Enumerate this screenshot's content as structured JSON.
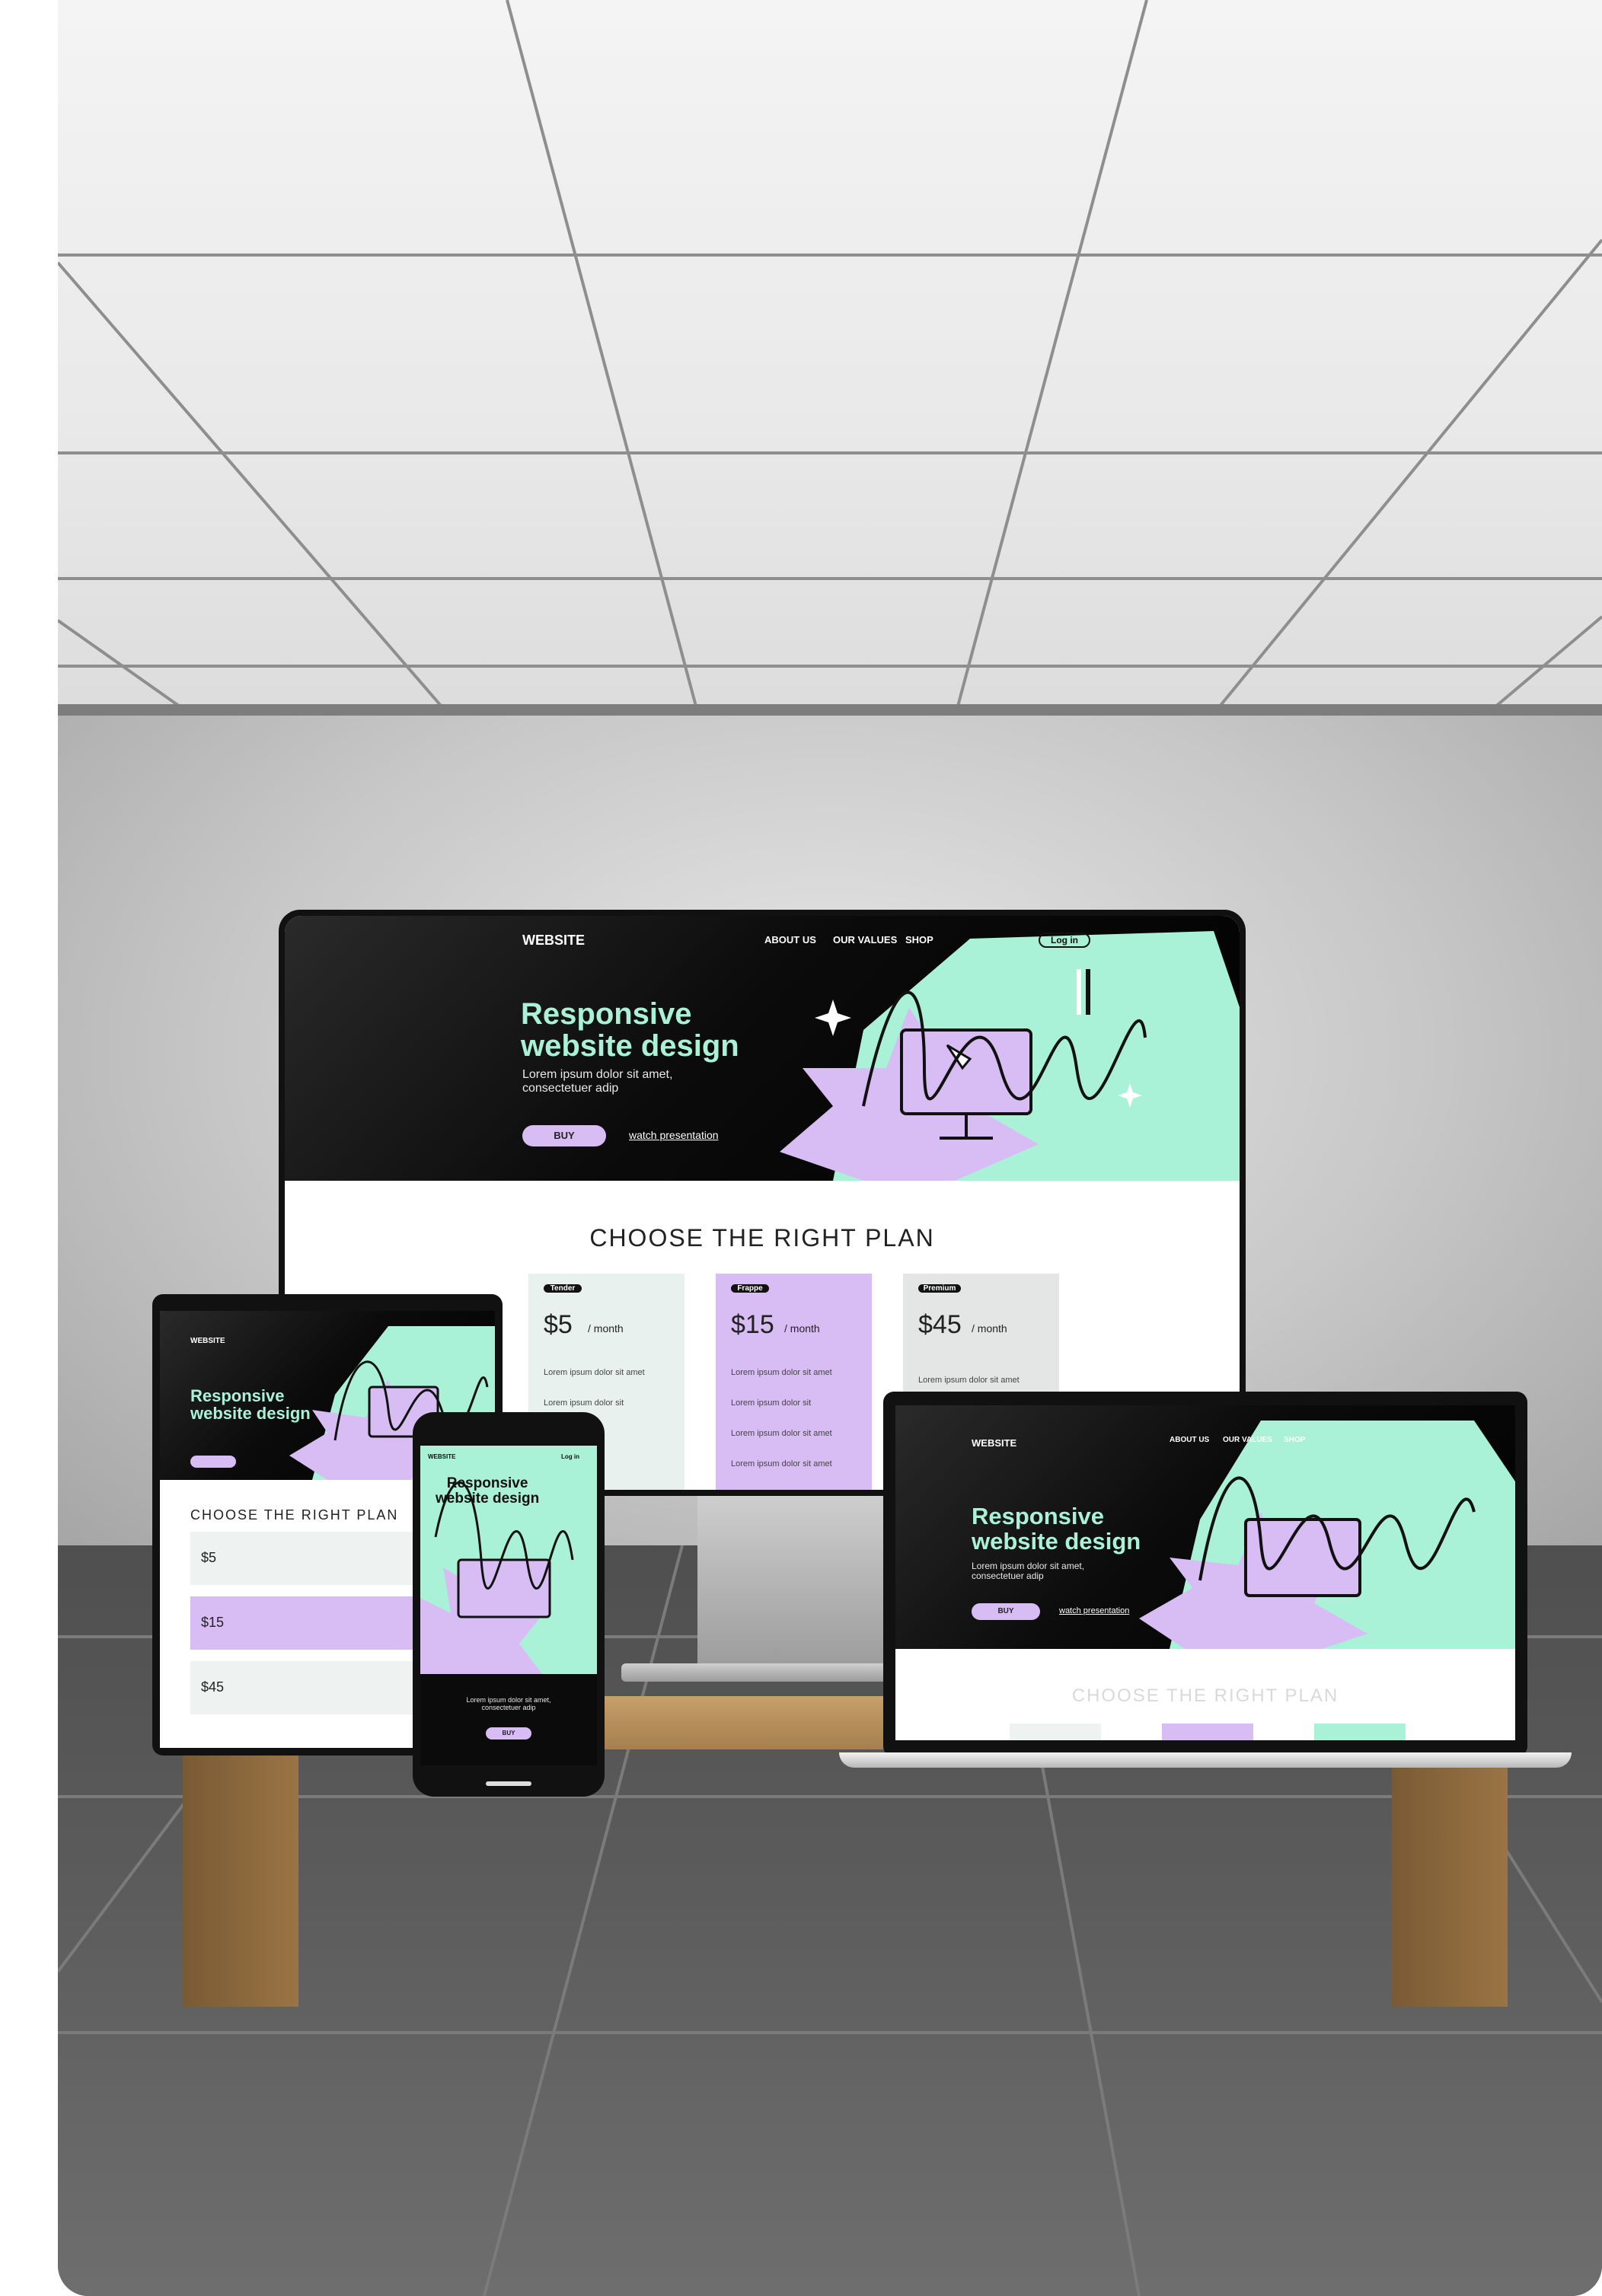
{
  "monitor": {
    "nav": {
      "logo": "WEBSITE",
      "items": [
        "ABOUT US",
        "OUR VALUES",
        "SHOP"
      ],
      "login": "Log in"
    },
    "hero": {
      "title": "Responsive\nwebsite design",
      "subtitle": "Lorem ipsum dolor sit amet,\nconsectetuer adip",
      "buy_label": "BUY",
      "watch_label": "watch presentation"
    },
    "pricing": {
      "title": "CHOOSE THE RIGHT PLAN",
      "plans": [
        {
          "tag": "Tender",
          "price": "$5",
          "unit": "/ month",
          "items": [
            "Lorem ipsum dolor sit amet",
            "Lorem ipsum dolor sit"
          ]
        },
        {
          "tag": "Frappe",
          "price": "$15",
          "unit": "/ month",
          "items": [
            "Lorem ipsum dolor sit amet",
            "Lorem ipsum dolor sit",
            "Lorem ipsum dolor sit amet",
            "Lorem ipsum dolor sit amet"
          ]
        },
        {
          "tag": "Premium",
          "price": "$45",
          "unit": "/ month",
          "items": [
            "Lorem ipsum dolor sit amet"
          ]
        }
      ]
    }
  },
  "tablet": {
    "logo": "WEBSITE",
    "title": "Responsive\nwebsite design",
    "plan_title": "CHOOSE THE RIGHT PLAN",
    "prices": [
      "$5",
      "$15",
      "$45"
    ]
  },
  "phone": {
    "logo": "WEBSITE",
    "login": "Log in",
    "title": "Responsive\nwebsite design",
    "subtitle": "Lorem ipsum dolor sit amet,\nconsectetuer adip",
    "buy_label": "BUY"
  },
  "laptop": {
    "logo": "WEBSITE",
    "nav": [
      "ABOUT US",
      "OUR VALUES",
      "SHOP"
    ],
    "title": "Responsive\nwebsite design",
    "subtitle": "Lorem ipsum dolor sit amet,\nconsectetuer adip",
    "buy_label": "BUY",
    "watch_label": "watch presentation",
    "plan_title": "CHOOSE THE RIGHT PLAN"
  },
  "colors": {
    "mint": "#a9f2d8",
    "lilac": "#d8bdf5",
    "dark": "#0b0b0b"
  }
}
